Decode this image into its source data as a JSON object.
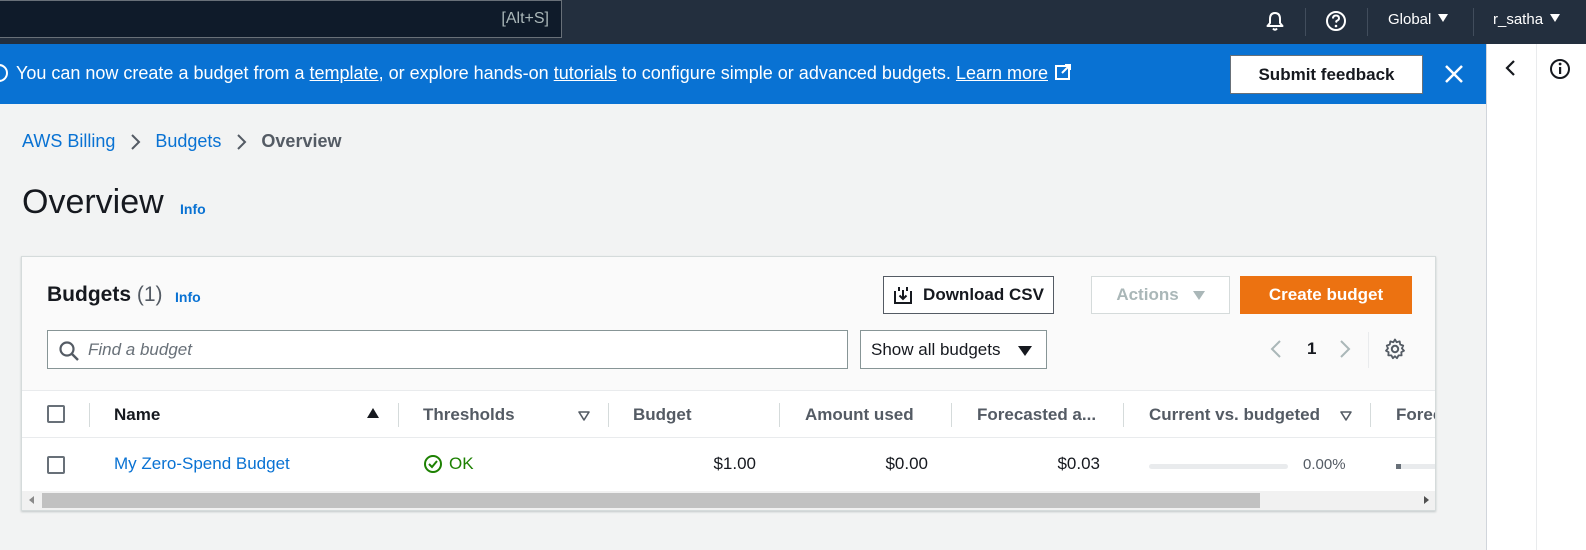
{
  "topnav": {
    "search_shortcut": "[Alt+S]",
    "icons": [
      "bell-icon",
      "help-icon"
    ],
    "region": "Global",
    "user": "r_satha"
  },
  "flashbar": {
    "text_before": "You can now create a budget from a ",
    "link_template": "template",
    "text_middle": ", or explore hands-on ",
    "link_tutorials": "tutorials",
    "text_after": " to configure simple or advanced budgets. ",
    "link_learn_more": "Learn more",
    "feedback_button": "Submit feedback",
    "background": "#0972d3"
  },
  "breadcrumb": {
    "items": [
      "AWS Billing",
      "Budgets",
      "Overview"
    ]
  },
  "page": {
    "title": "Overview",
    "info": "Info"
  },
  "budgets_panel": {
    "title": "Budgets",
    "count": "(1)",
    "info": "Info",
    "download_csv": "Download CSV",
    "actions": "Actions",
    "create_budget": "Create budget",
    "create_color": "#ec7211",
    "search_placeholder": "Find a budget",
    "filter_value": "Show all budgets",
    "current_page": "1"
  },
  "table": {
    "columns": [
      "Name",
      "Thresholds",
      "Budget",
      "Amount used",
      "Forecasted a...",
      "Current vs. budgeted",
      "Forec"
    ],
    "rows": [
      {
        "name": "My Zero-Spend Budget",
        "threshold": "OK",
        "budget": "$1.00",
        "amount_used": "$0.00",
        "forecasted": "$0.03",
        "current_vs_budgeted": "0.00%",
        "current_vs_budgeted_fraction": 0.0
      }
    ]
  }
}
